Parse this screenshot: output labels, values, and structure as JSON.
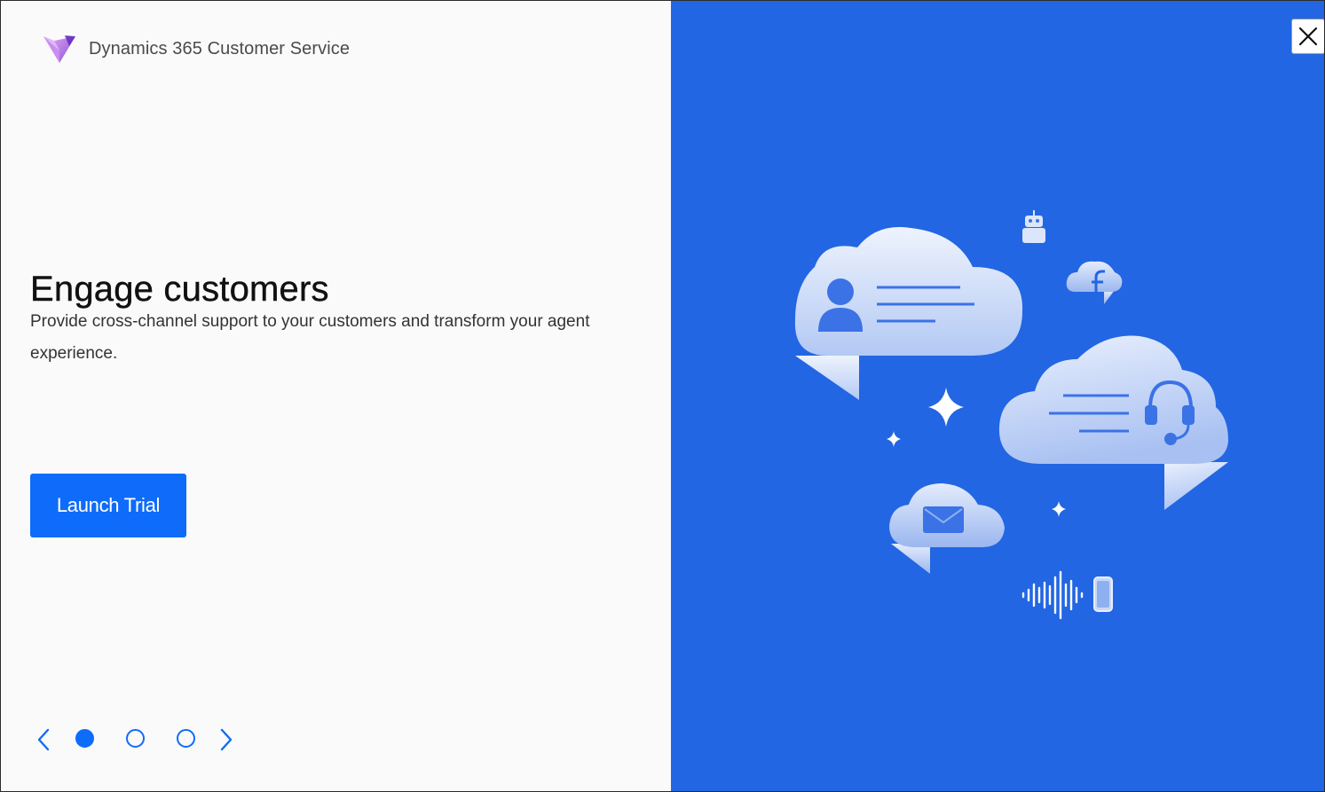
{
  "brand": {
    "name": "Dynamics 365 Customer Service",
    "logo_icon": "dynamics-heart-logo-icon"
  },
  "slide": {
    "title": "Engage customers",
    "description": "Provide cross-channel support to your customers and transform your agent experience.",
    "cta_label": "Launch Trial"
  },
  "pager": {
    "total_pages": 3,
    "current_page": 1,
    "prev_icon": "chevron-left-icon",
    "next_icon": "chevron-right-icon"
  },
  "dialog": {
    "close_icon": "close-icon"
  },
  "colors": {
    "accent": "#0f6cfa",
    "panel_blue": "#2266e3",
    "cloud_light": "#e7eefc",
    "cloud_dark": "#a8c0f2",
    "background": "#fafafa"
  },
  "illustration": {
    "icons": [
      "person-icon",
      "robot-icon",
      "facebook-icon",
      "headset-icon",
      "sparkle-icon",
      "mail-icon",
      "soundwave-icon",
      "phone-icon"
    ]
  }
}
